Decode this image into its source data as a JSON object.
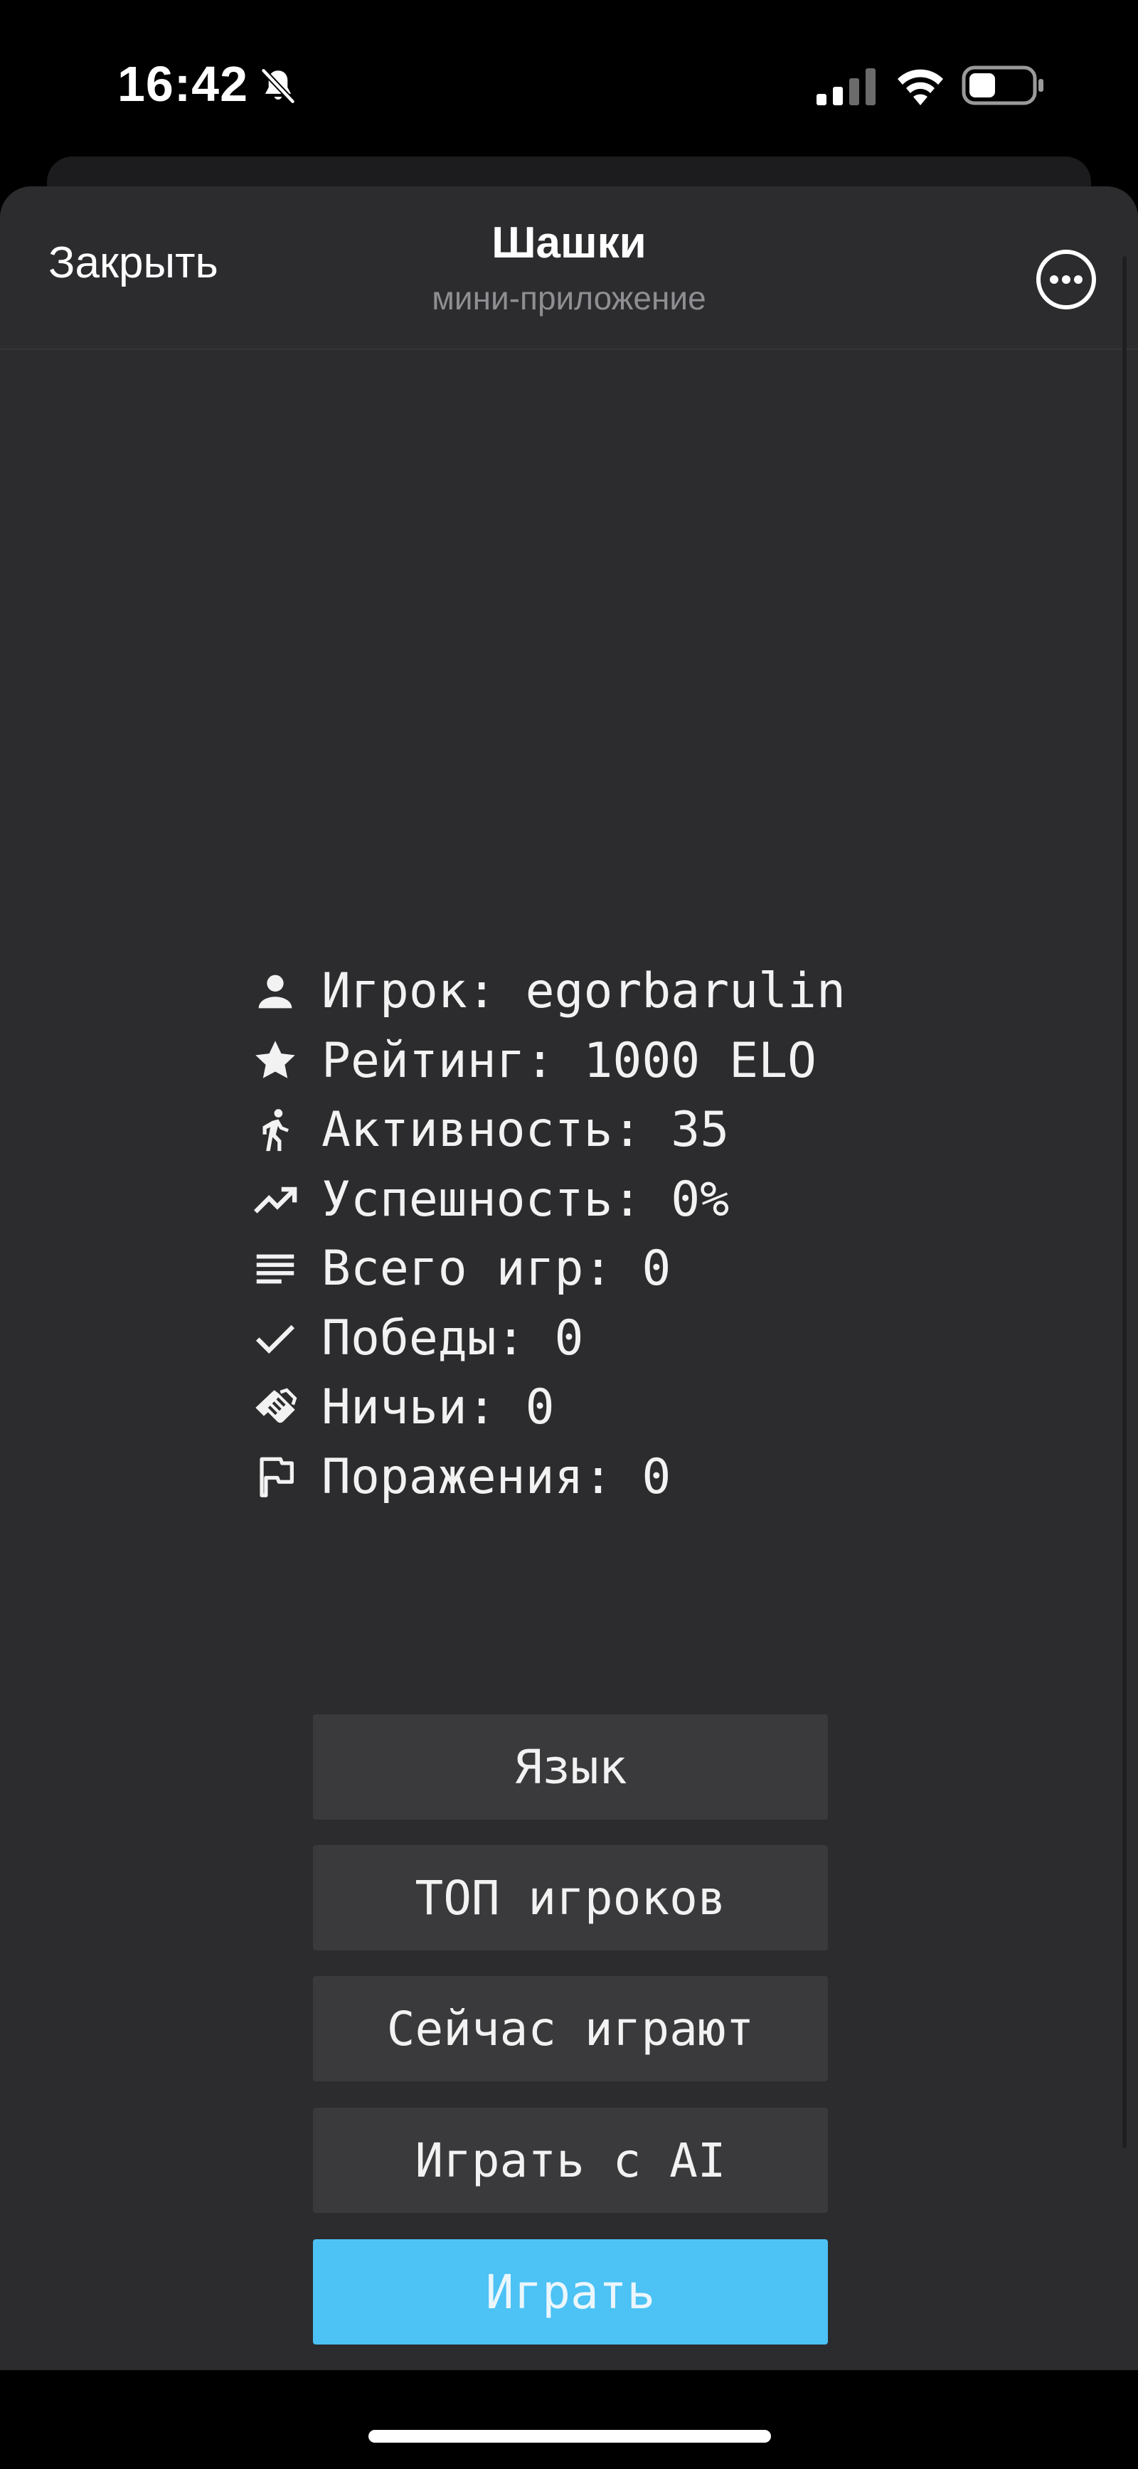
{
  "status_bar": {
    "time": "16:42",
    "icons": [
      "bell-slash-icon",
      "cellular-signal-icon",
      "wifi-icon",
      "battery-icon"
    ]
  },
  "header": {
    "close_label": "Закрыть",
    "title": "Шашки",
    "subtitle": "мини-приложение",
    "more_icon": "more-circle-icon"
  },
  "stats": [
    {
      "icon": "person-icon",
      "label": "Игрок: egorbarulin"
    },
    {
      "icon": "star-icon",
      "label": "Рейтинг: 1000 ELO"
    },
    {
      "icon": "walking-icon",
      "label": "Активность: 35"
    },
    {
      "icon": "trending-up-icon",
      "label": "Успешность: 0%"
    },
    {
      "icon": "list-icon",
      "label": "Всего игр: 0"
    },
    {
      "icon": "check-icon",
      "label": "Победы: 0"
    },
    {
      "icon": "handshake-icon",
      "label": "Ничьи: 0"
    },
    {
      "icon": "flag-icon",
      "label": "Поражения: 0"
    }
  ],
  "buttons": {
    "language": "Язык",
    "top_players": "ТОП игроков",
    "now_playing": "Сейчас играют",
    "play_ai": "Играть с AI",
    "play": "Играть"
  },
  "colors": {
    "background": "#2c2c2e",
    "button": "#3a3a3c",
    "primary": "#4cc2f5",
    "text": "#f2f2f2",
    "subtitle": "#8e8e93"
  }
}
